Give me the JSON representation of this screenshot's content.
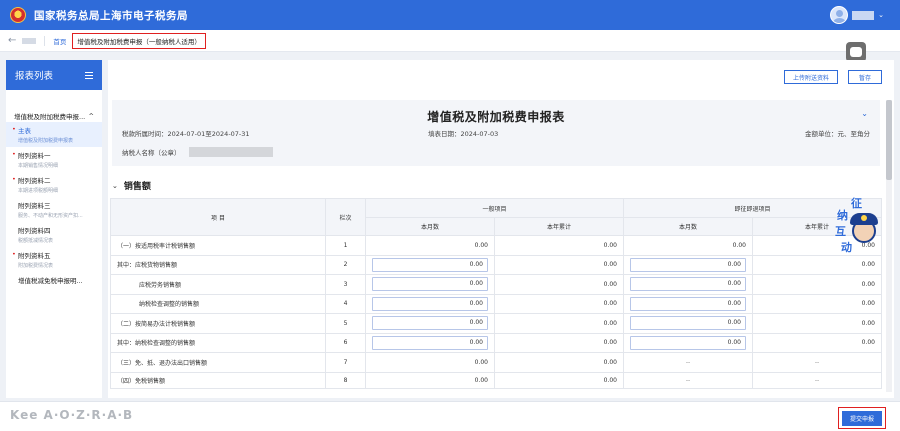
{
  "header": {
    "site_title": "国家税务总局上海市电子税务局",
    "user_caret": "⌄"
  },
  "breadcrumb": {
    "back_icon": "←",
    "home": "首页",
    "current": "增值税及附加税费申报（一般纳税人适用）"
  },
  "sidebar": {
    "title": "报表列表",
    "section": "增值税及附加税费申报...",
    "section_caret": "^",
    "items": [
      {
        "label": "主表",
        "sub": "增值税及附加税费申报表",
        "active": true,
        "dot": true
      },
      {
        "label": "附列资料一",
        "sub": "本期销售情况明细",
        "active": false,
        "dot": true
      },
      {
        "label": "附列资料二",
        "sub": "本期进项税额明细",
        "active": false,
        "dot": true
      },
      {
        "label": "附列资料三",
        "sub": "服务、不动产和无形资产扣...",
        "active": false,
        "dot": false
      },
      {
        "label": "附列资料四",
        "sub": "税额抵减情况表",
        "active": false,
        "dot": false
      },
      {
        "label": "附列资料五",
        "sub": "附加税费情况表",
        "active": false,
        "dot": true
      },
      {
        "label": "增值税减免税申报明...",
        "sub": "",
        "active": false,
        "dot": false
      }
    ]
  },
  "toolbar": {
    "upload_label": "上传附送资料",
    "save_label": "暂存"
  },
  "form": {
    "title": "增值税及附加税费申报表",
    "period": "税款所属时间：2024-07-01至2024-07-31",
    "fill_date": "填表日期：2024-07-03",
    "unit": "金额单位：元、至角分",
    "taxpayer_label": "纳税人名称（公章）",
    "collapse_icon": "chevron-down-icon"
  },
  "section": {
    "title": "销售额",
    "chevron": "⌄"
  },
  "table": {
    "headers": {
      "item": "项 目",
      "column": "栏次",
      "general": "一般项目",
      "immediate": "即征即退项目",
      "month": "本月数",
      "ytd": "本年累计"
    },
    "rows": [
      {
        "item": "（一）按适用税率计税销售额",
        "col": "1",
        "c1": "0.00",
        "c2": "0.00",
        "c3": "0.00",
        "c4": "0.00",
        "inputs": [
          false,
          false,
          false,
          false
        ]
      },
      {
        "item": "其中：应税货物销售额",
        "col": "2",
        "c1": "0.00",
        "c2": "0.00",
        "c3": "0.00",
        "c4": "0.00",
        "inputs": [
          true,
          false,
          true,
          false
        ]
      },
      {
        "item": "应税劳务销售额",
        "col": "3",
        "c1": "0.00",
        "c2": "0.00",
        "c3": "0.00",
        "c4": "0.00",
        "inputs": [
          true,
          false,
          true,
          false
        ],
        "indent": true
      },
      {
        "item": "纳税检查调整的销售额",
        "col": "4",
        "c1": "0.00",
        "c2": "0.00",
        "c3": "0.00",
        "c4": "0.00",
        "inputs": [
          true,
          false,
          true,
          false
        ],
        "indent": true
      },
      {
        "item": "（二）按简易办法计税销售额",
        "col": "5",
        "c1": "0.00",
        "c2": "0.00",
        "c3": "0.00",
        "c4": "0.00",
        "inputs": [
          true,
          false,
          true,
          false
        ]
      },
      {
        "item": "其中：纳税检查调整的销售额",
        "col": "6",
        "c1": "0.00",
        "c2": "0.00",
        "c3": "0.00",
        "c4": "0.00",
        "inputs": [
          true,
          false,
          true,
          false
        ]
      },
      {
        "item": "（三）免、抵、退办法出口销售额",
        "col": "7",
        "c1": "0.00",
        "c2": "0.00",
        "c3": "--",
        "c4": "--",
        "inputs": [
          false,
          false,
          false,
          false
        ]
      },
      {
        "item": "（四）免税销售额",
        "col": "8",
        "c1": "0.00",
        "c2": "0.00",
        "c3": "--",
        "c4": "--",
        "inputs": [
          false,
          false,
          false,
          false
        ]
      }
    ]
  },
  "mascot": {
    "chars": [
      "征",
      "纳",
      "互",
      "动"
    ]
  },
  "footer": {
    "watermark": "Kee A·O·Z·R·A·B",
    "submit_label": "提交申报"
  }
}
